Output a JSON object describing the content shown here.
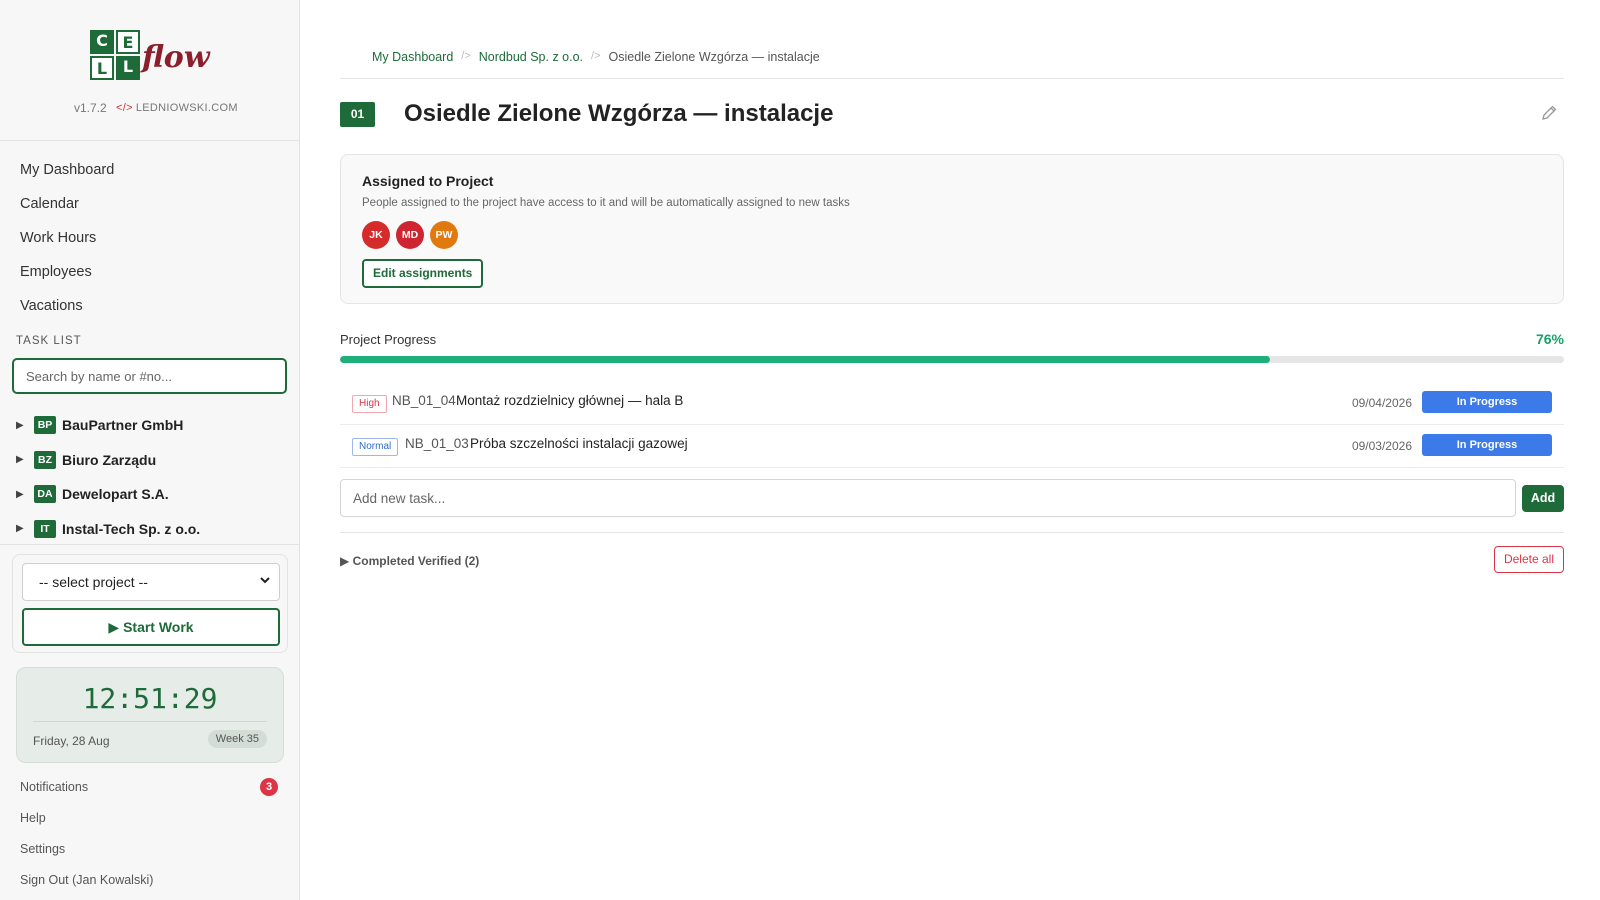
{
  "app": {
    "logo_letters": [
      "C",
      "E",
      "L",
      "L"
    ],
    "logo_word": "flow",
    "version": "v1.7.2",
    "author_code": "</>",
    "author": "LEDNIOWSKI.COM"
  },
  "sidebar": {
    "nav": [
      "My Dashboard",
      "Calendar",
      "Work Hours",
      "Employees",
      "Vacations"
    ],
    "task_list_label": "TASK LIST",
    "search_placeholder": "Search by name or #no...",
    "clients": [
      {
        "badge": "BP",
        "name": "BauPartner GmbH"
      },
      {
        "badge": "BZ",
        "name": "Biuro Zarządu"
      },
      {
        "badge": "DA",
        "name": "Dewelopart S.A."
      },
      {
        "badge": "IT",
        "name": "Instal-Tech Sp. z o.o."
      }
    ],
    "project_select": "-- select project --",
    "start_work": "Start Work",
    "clock": {
      "time": "12:51:29",
      "date": "Friday, 28 Aug",
      "week": "Week 35"
    },
    "bottom_links": {
      "notifications": "Notifications",
      "notifications_count": "3",
      "help": "Help",
      "settings": "Settings",
      "sign_out": "Sign Out (Jan Kowalski)"
    }
  },
  "breadcrumb": {
    "items": [
      "My Dashboard",
      "Nordbud Sp. z o.o.",
      "Osiedle Zielone Wzgórza — instalacje"
    ],
    "separator": "/>"
  },
  "project": {
    "number": "01",
    "title": "Osiedle Zielone Wzgórza — instalacje"
  },
  "assigned": {
    "title": "Assigned to Project",
    "description": "People assigned to the project have access to it and will be automatically assigned to new tasks",
    "avatars": [
      {
        "initials": "JK",
        "color": "#d62b2b"
      },
      {
        "initials": "MD",
        "color": "#cf2530"
      },
      {
        "initials": "PW",
        "color": "#e07a10"
      }
    ],
    "edit_button": "Edit assignments"
  },
  "progress": {
    "label": "Project Progress",
    "percent_text": "76%",
    "value": 0.76,
    "fill_color": "#1db07a"
  },
  "tasks": [
    {
      "priority": "High",
      "code": "NB_01_04",
      "name": "Montaż rozdzielnicy głównej — hala B",
      "date": "09/04/2026",
      "status": "In Progress"
    },
    {
      "priority": "Normal",
      "code": "NB_01_03",
      "name": "Próba szczelności instalacji gazowej",
      "date": "09/03/2026",
      "status": "In Progress"
    }
  ],
  "add_task": {
    "placeholder": "Add new task...",
    "button": "Add"
  },
  "completed": {
    "label": "Completed Verified (2)",
    "delete_all": "Delete all"
  },
  "colors": {
    "brand": "#1e6b39",
    "status_blue": "#3b7ae8",
    "danger": "#dc3545",
    "logo_accent": "#8b1f2b"
  },
  "icons": {
    "edit": "pencil-icon",
    "expand": "triangle-right-icon",
    "play": "play-icon",
    "dropdown": "chevron-down-icon"
  }
}
